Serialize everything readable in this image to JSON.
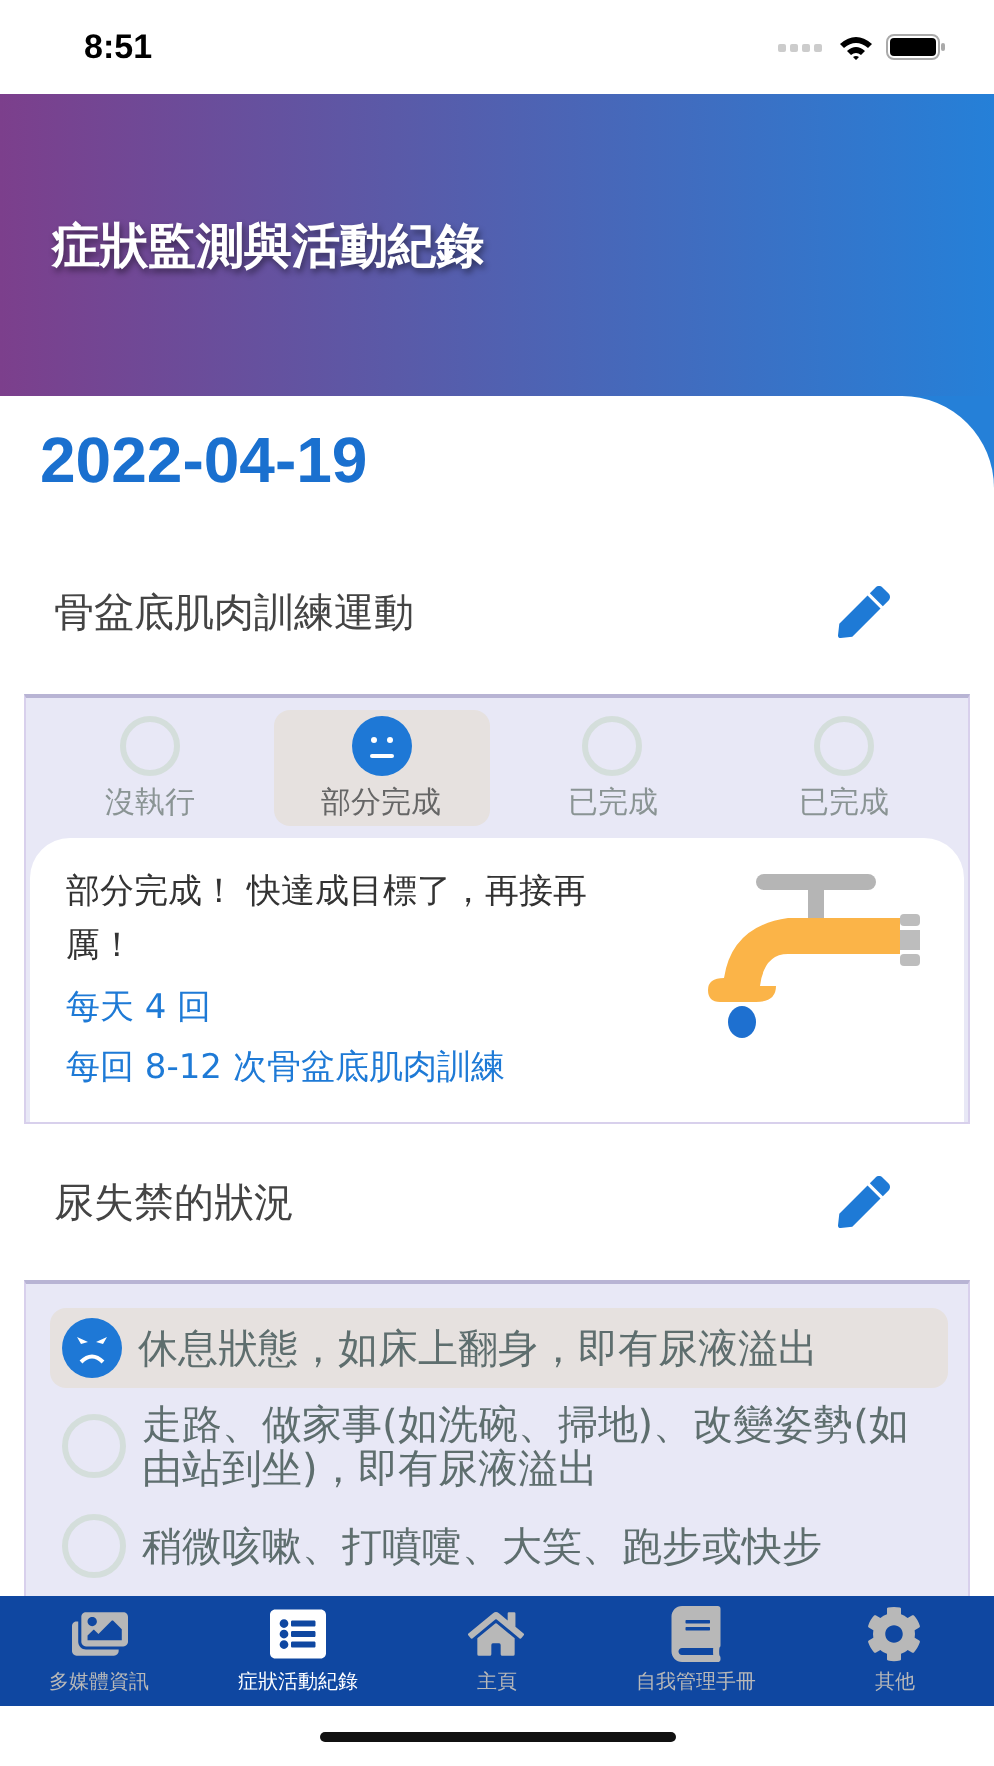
{
  "status_bar": {
    "time": "8:51"
  },
  "header": {
    "title": "症狀監測與活動紀錄"
  },
  "date": "2022-04-19",
  "sections": [
    {
      "heading": "骨盆底肌肉訓練運動",
      "kind": "row",
      "options": [
        {
          "label": "沒執行",
          "selected": false
        },
        {
          "label": "部分完成",
          "selected": true
        },
        {
          "label": "已完成",
          "selected": false
        },
        {
          "label": "已完成",
          "selected": false
        }
      ],
      "feedback": {
        "message": "部分完成！ 快達成目標了，再接再厲！",
        "details": [
          "每天 4 回",
          "每回 8-12 次骨盆底肌肉訓練"
        ]
      }
    },
    {
      "heading": "尿失禁的狀況",
      "kind": "list",
      "options": [
        {
          "label": "休息狀態，如床上翻身，即有尿液溢出",
          "selected": true
        },
        {
          "label": "走路、做家事(如洗碗、掃地)、改變姿勢(如由站到坐)，即有尿液溢出",
          "selected": false
        },
        {
          "label": "稍微咳嗽、打噴嚏、大笑、跑步或快步",
          "selected": false
        }
      ]
    }
  ],
  "tab_bar": [
    {
      "label": "多媒體資訊",
      "kind": "images",
      "selected": false
    },
    {
      "label": "症狀活動紀錄",
      "kind": "list",
      "selected": true
    },
    {
      "label": "主頁",
      "kind": "home",
      "selected": false
    },
    {
      "label": "自我管理手冊",
      "kind": "book",
      "selected": false
    },
    {
      "label": "其他",
      "kind": "gear",
      "selected": false
    }
  ]
}
